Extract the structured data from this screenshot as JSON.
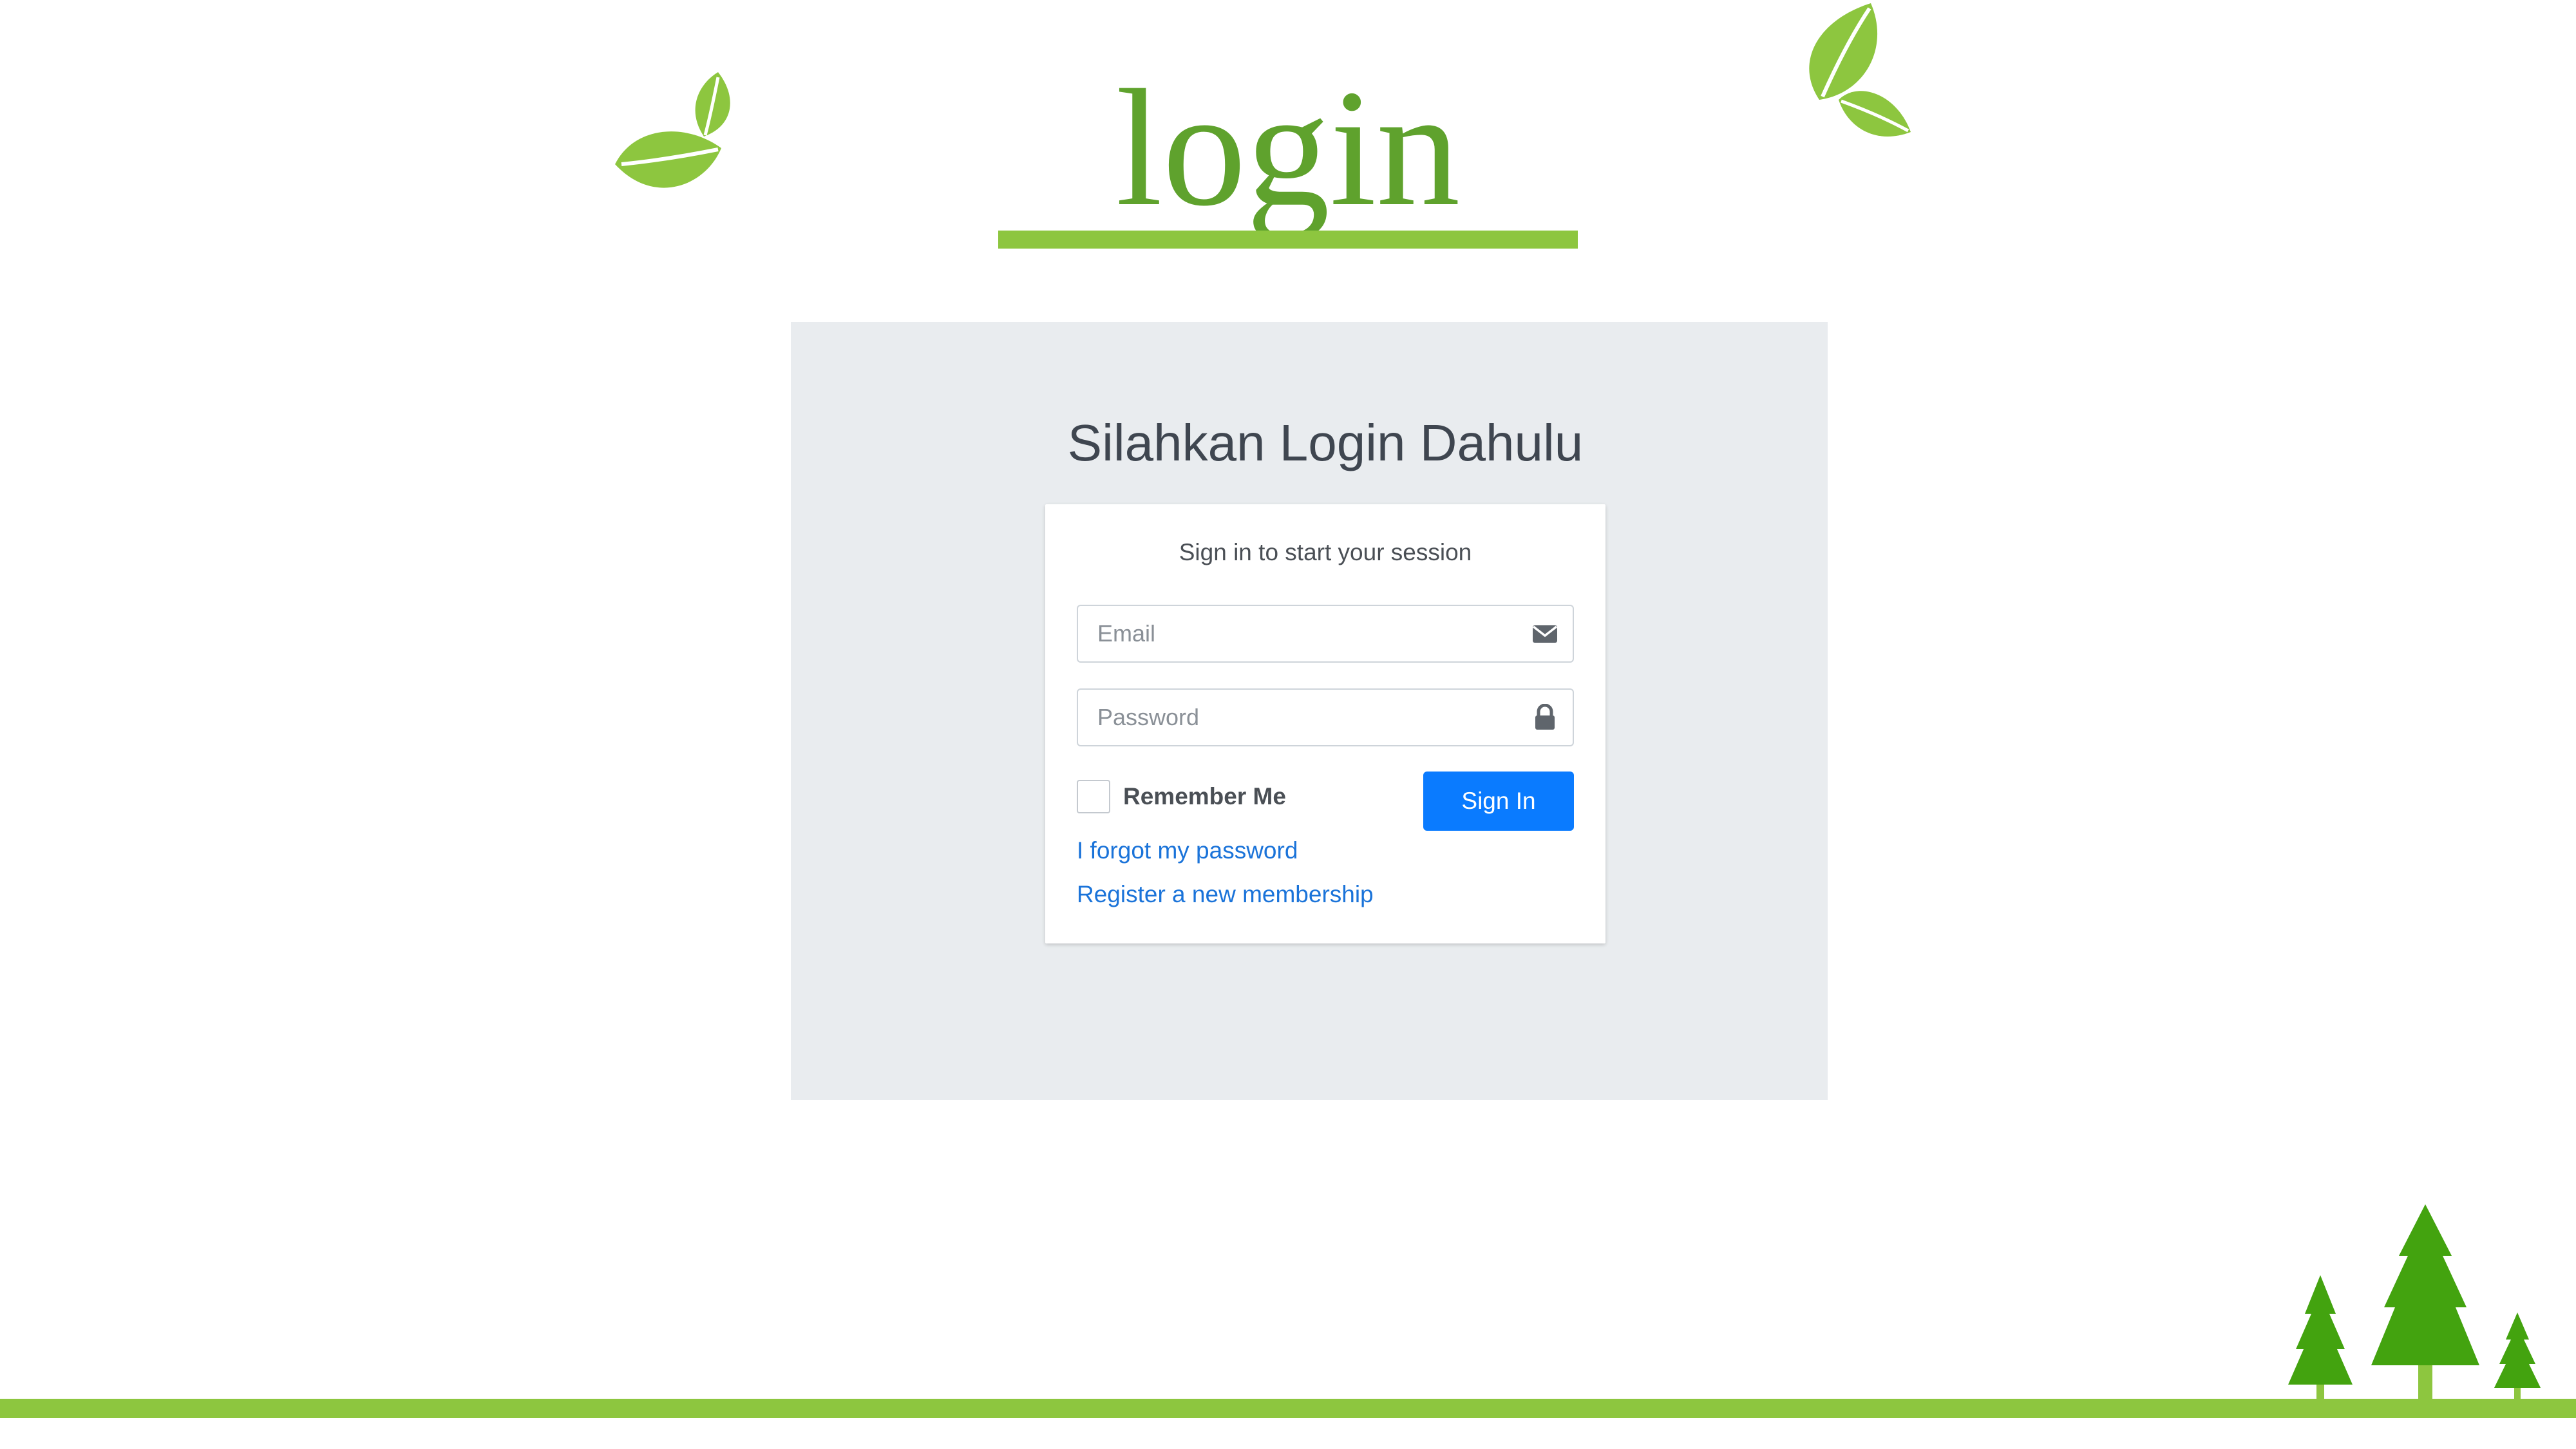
{
  "header": {
    "title": "login"
  },
  "panel": {
    "heading": "Silahkan Login Dahulu"
  },
  "card": {
    "message": "Sign in to start your session",
    "email": {
      "value": "",
      "placeholder": "Email",
      "icon": "envelope-icon"
    },
    "password": {
      "value": "",
      "placeholder": "Password",
      "icon": "lock-icon"
    },
    "remember_me": {
      "label": "Remember Me",
      "checked": false
    },
    "sign_in_label": "Sign In",
    "forgot_password_link": "I forgot my password",
    "register_link": "Register a new membership"
  },
  "decorations": {
    "leaves_icon": "leaf-icon",
    "trees_icon": "pine-tree-icon"
  },
  "colors": {
    "brand_green": "#5fa22d",
    "accent_green": "#8dc63f",
    "primary_button": "#0a7bff",
    "link": "#1a73d9",
    "panel_background": "#e9ecef"
  }
}
